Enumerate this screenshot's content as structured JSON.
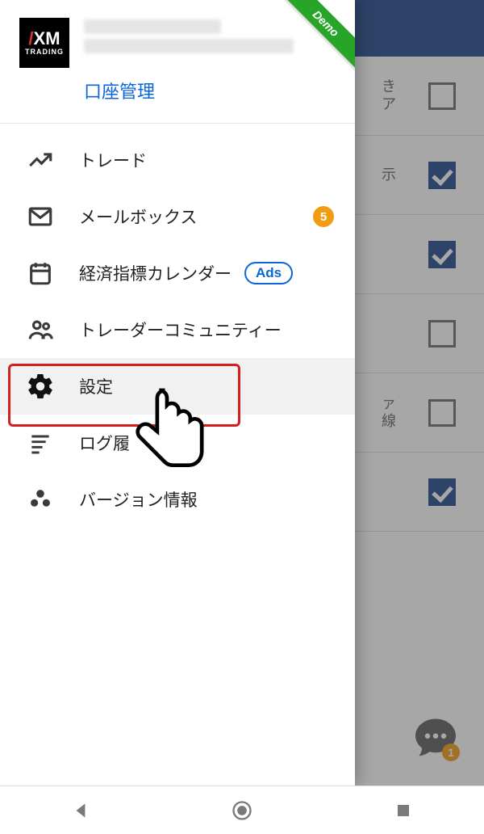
{
  "brand": {
    "logo_top_pre": "X",
    "logo_top_post": "M",
    "logo_bottom": "TRADING"
  },
  "ribbon": {
    "text": "Demo"
  },
  "account": {
    "manage_link": "口座管理"
  },
  "menu": {
    "trade": "トレード",
    "mailbox": "メールボックス",
    "mailbox_count": "5",
    "calendar": "経済指標カレンダー",
    "ads_label": "Ads",
    "community": "トレーダーコミュニティー",
    "settings": "設定",
    "log": "ログ履",
    "about": "バージョン情報"
  },
  "bg": {
    "rows": [
      {
        "label_tail": "き\nア",
        "checked": false
      },
      {
        "label_tail": "示",
        "checked": true
      },
      {
        "label_tail": "",
        "checked": true
      },
      {
        "label_tail": "",
        "checked": false
      },
      {
        "label_tail": "ァ\n線",
        "checked": false
      },
      {
        "label_tail": "",
        "checked": true
      }
    ],
    "chat_count": "1"
  }
}
